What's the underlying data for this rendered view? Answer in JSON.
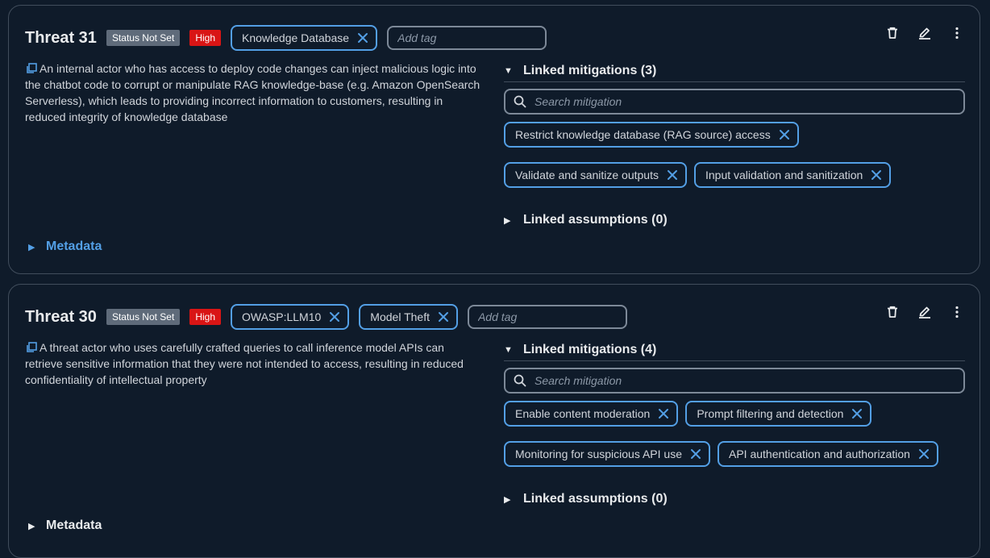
{
  "colors": {
    "background": "#0f1b2a",
    "border": "#414d5c",
    "accent": "#539fe5",
    "status_badge": "#5f6b7a",
    "priority_badge": "#d91515"
  },
  "threats": [
    {
      "title": "Threat 31",
      "status": "Status Not Set",
      "priority": "High",
      "tags": [
        "Knowledge Database"
      ],
      "add_tag_placeholder": "Add tag",
      "statement": "An internal actor who has access to deploy code changes can inject malicious logic into the chatbot code to corrupt or manipulate RAG knowledge-base (e.g. Amazon OpenSearch Serverless), which leads to providing incorrect information to customers, resulting in reduced integrity of knowledge database",
      "linked_mitigations_label": "Linked mitigations (3)",
      "search_placeholder": "Search mitigation",
      "mitigations": [
        "Restrict knowledge database (RAG source) access",
        "Validate and sanitize outputs",
        "Input validation and sanitization"
      ],
      "linked_assumptions_label": "Linked assumptions (0)",
      "metadata_label": "Metadata"
    },
    {
      "title": "Threat 30",
      "status": "Status Not Set",
      "priority": "High",
      "tags": [
        "OWASP:LLM10",
        "Model Theft"
      ],
      "add_tag_placeholder": "Add tag",
      "statement": "A threat actor who uses carefully crafted queries to call inference model APIs can retrieve sensitive information that they were not intended to access, resulting in reduced confidentiality of intellectual property",
      "linked_mitigations_label": "Linked mitigations (4)",
      "search_placeholder": "Search mitigation",
      "mitigations": [
        "Enable content moderation",
        "Prompt filtering and detection",
        "Monitoring for suspicious API use",
        "API authentication and authorization"
      ],
      "linked_assumptions_label": "Linked assumptions (0)",
      "metadata_label": "Metadata"
    }
  ],
  "icons": {
    "delete": "trash-icon",
    "edit": "pencil-icon",
    "more": "more-vertical-icon",
    "copy": "copy-icon",
    "search": "search-icon",
    "remove": "close-icon",
    "expanded": "caret-down-icon",
    "collapsed": "caret-right-icon"
  }
}
